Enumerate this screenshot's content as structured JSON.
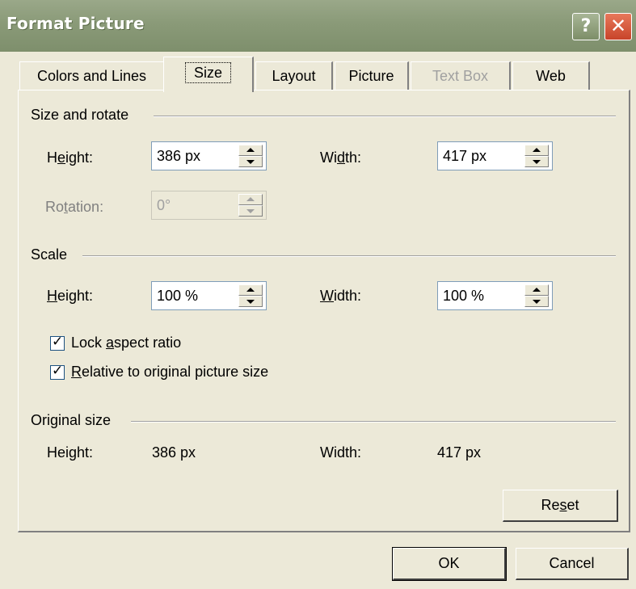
{
  "window": {
    "title": "Format Picture",
    "help_glyph": "?",
    "close_glyph": "✕"
  },
  "tabs": [
    {
      "label": "Colors and Lines",
      "state": "normal"
    },
    {
      "label": "Size",
      "state": "active"
    },
    {
      "label": "Layout",
      "state": "normal"
    },
    {
      "label": "Picture",
      "state": "normal"
    },
    {
      "label": "Text Box",
      "state": "disabled"
    },
    {
      "label": "Web",
      "state": "normal"
    }
  ],
  "size_rotate": {
    "group_label": "Size and rotate",
    "height_label_a": "H",
    "height_label_u": "e",
    "height_label_b": "ight:",
    "height_value": "386 px",
    "width_label_a": "Wi",
    "width_label_u": "d",
    "width_label_b": "th:",
    "width_value": "417 px",
    "rotation_label_a": "Ro",
    "rotation_label_u": "t",
    "rotation_label_b": "ation:",
    "rotation_value": "0°"
  },
  "scale": {
    "group_label": "Scale",
    "height_label_u": "H",
    "height_label_b": "eight:",
    "height_value": "100 %",
    "width_label_u": "W",
    "width_label_b": "idth:",
    "width_value": "100 %",
    "lock_aspect_a": "Lock ",
    "lock_aspect_u": "a",
    "lock_aspect_b": "spect ratio",
    "lock_aspect_checked": true,
    "relative_u": "R",
    "relative_b": "elative to original picture size",
    "relative_checked": true
  },
  "original": {
    "group_label": "Original size",
    "height_label": "Height:",
    "height_value": "386 px",
    "width_label": "Width:",
    "width_value": "417 px",
    "reset_a": "Re",
    "reset_u": "s",
    "reset_b": "et"
  },
  "footer": {
    "ok_label": "OK",
    "cancel_label": "Cancel"
  },
  "colors": {
    "dialog_bg": "#ece9d8",
    "titlebar": "#8a9a78",
    "close_button": "#c8442a"
  }
}
